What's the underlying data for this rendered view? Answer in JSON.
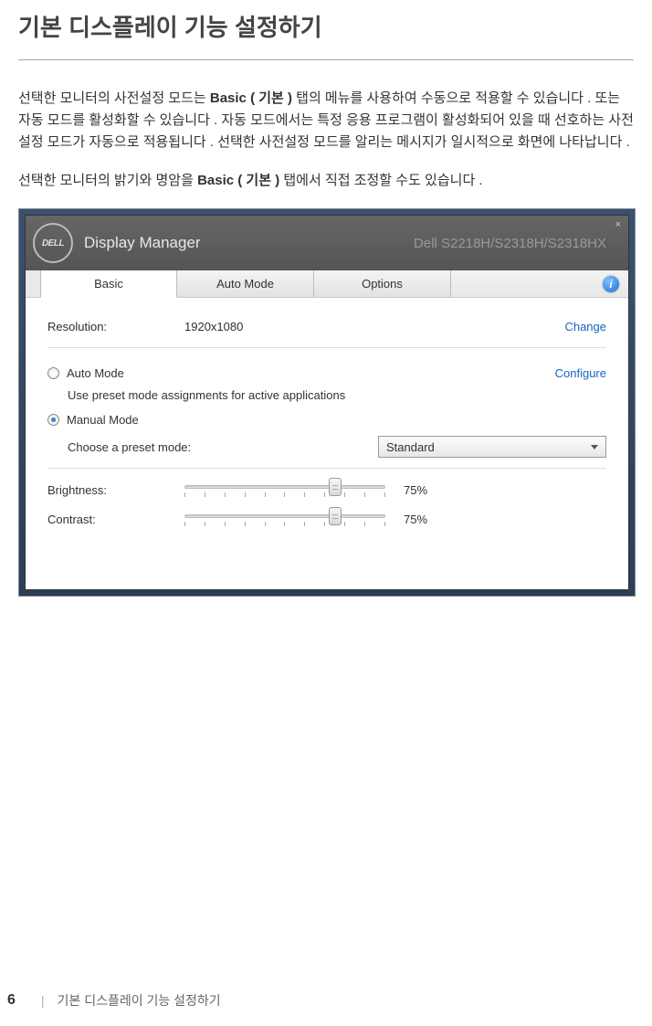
{
  "page": {
    "title": "기본 디스플레이 기능 설정하기",
    "paragraph1_a": "선택한 모니터의 사전설정 모드는 ",
    "paragraph1_bold1": "Basic ( 기본 )",
    "paragraph1_b": " 탭의 메뉴를 사용하여 수동으로 적용할 수 있습니다 . 또는 자동 모드를 활성화할 수 있습니다 . 자동 모드에서는 특정 응용 프로그램이 활성화되어 있을 때 선호하는 사전설정 모드가 자동으로 적용됩니다 . 선택한 사전설정 모드를 알리는 메시지가 일시적으로 화면에 나타납니다 .",
    "paragraph2_a": "선택한 모니터의 밝기와 명암을 ",
    "paragraph2_bold": "Basic ( 기본 )",
    "paragraph2_b": " 탭에서 직접 조정할 수도 있습니다 ."
  },
  "app": {
    "logo_text": "DELL",
    "title": "Display Manager",
    "monitor": "Dell S2218H/S2318H/S2318HX",
    "close": "×",
    "tabs": {
      "basic": "Basic",
      "auto": "Auto Mode",
      "options": "Options"
    },
    "info_icon": "i",
    "resolution_label": "Resolution:",
    "resolution_value": "1920x1080",
    "change_link": "Change",
    "auto_mode_label": "Auto Mode",
    "auto_mode_desc": "Use preset mode assignments for active applications",
    "configure_link": "Configure",
    "manual_mode_label": "Manual Mode",
    "manual_mode_desc": "Choose a preset mode:",
    "dropdown_value": "Standard",
    "brightness_label": "Brightness:",
    "brightness_value": "75%",
    "contrast_label": "Contrast:",
    "contrast_value": "75%"
  },
  "footer": {
    "page_num": "6",
    "sep": "|",
    "section": "기본 디스플레이 기능 설정하기"
  }
}
